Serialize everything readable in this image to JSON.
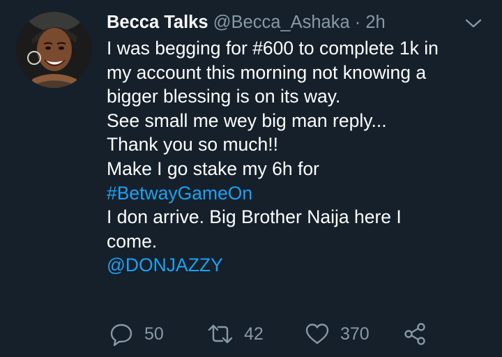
{
  "tweet": {
    "display_name": "Becca Talks",
    "handle": "@Becca_Ashaka",
    "separator": "·",
    "time": "2h",
    "lines": [
      "I was begging for #600 to complete 1k in",
      "my account this morning not knowing a",
      "bigger blessing is on its way.",
      "See small me wey big man reply...",
      "Thank you so much!!",
      "Make I go stake my 6h for",
      "#BetwayGameOn",
      "I don arrive. Big Brother Naija here I",
      "come.",
      "@DONJAZZY"
    ],
    "hashtag": "#BetwayGameOn",
    "mention": "@DONJAZZY"
  },
  "actions": {
    "reply_count": "50",
    "retweet_count": "42",
    "like_count": "370"
  },
  "icons": [
    "avatar-photo",
    "chevron-down-icon",
    "reply-icon",
    "retweet-icon",
    "like-icon",
    "share-icon"
  ],
  "colors": {
    "background": "#15202b",
    "text": "#ffffff",
    "secondary": "#8899a6",
    "link": "#1da1f2"
  }
}
